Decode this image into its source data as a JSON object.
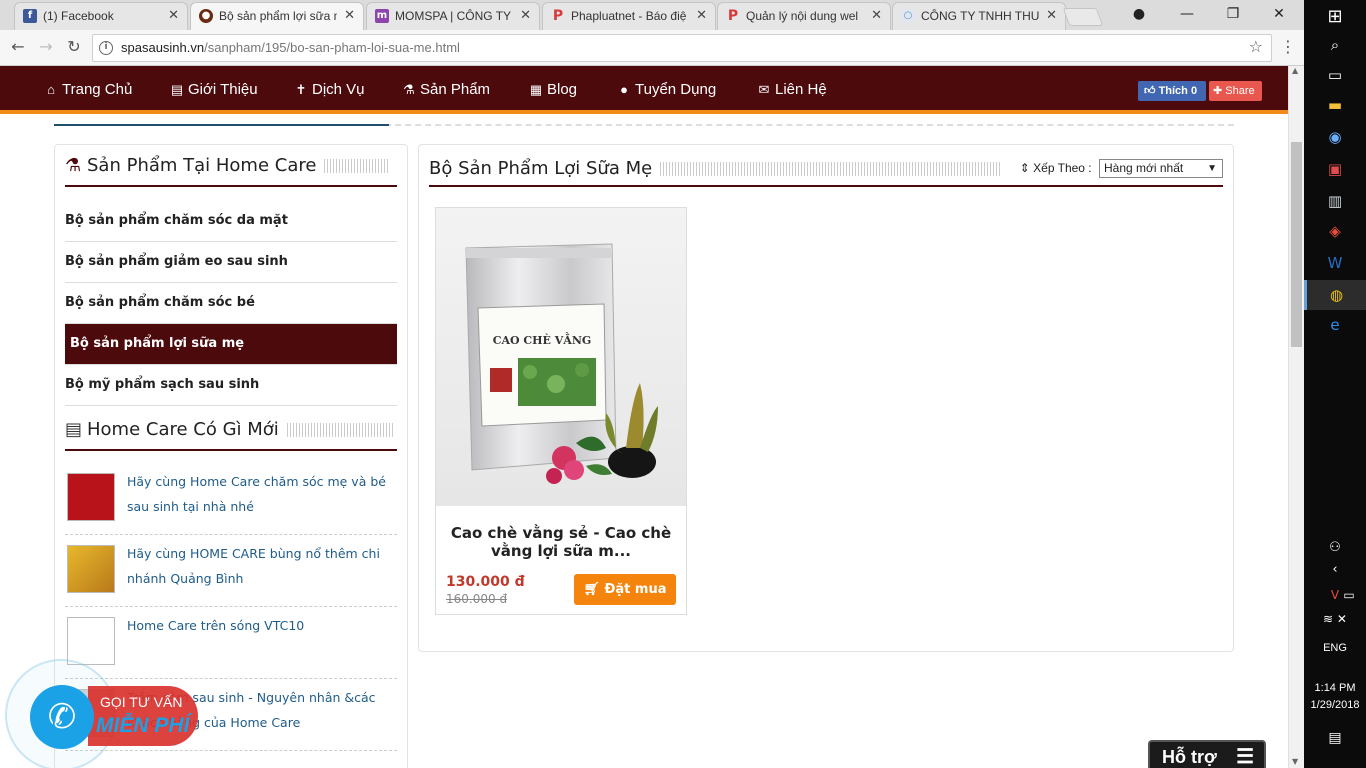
{
  "browser": {
    "tabs": [
      {
        "title": "(1) Facebook",
        "favicon": "facebook-icon",
        "color": "#3b5998",
        "glyph": "f"
      },
      {
        "title": "Bộ sản phẩm lợi sữa m",
        "favicon": "site-icon",
        "color": "#6b2a10",
        "glyph": "●"
      },
      {
        "title": "MOMSPA | CÔNG TY",
        "favicon": "momspa-icon",
        "color": "#8e44ad",
        "glyph": "m"
      },
      {
        "title": "Phapluatnet - Báo điệ",
        "favicon": "phapluat-icon",
        "color": "#d63a3a",
        "glyph": "P"
      },
      {
        "title": "Quản lý nội dung wel",
        "favicon": "phapluat-icon",
        "color": "#d63a3a",
        "glyph": "P"
      },
      {
        "title": "CÔNG TY TNHH THU",
        "favicon": "globe-icon",
        "color": "#6b8fb5",
        "glyph": "○"
      }
    ],
    "url_host": "spasausinh.vn",
    "url_path": "/sanpham/195/bo-san-pham-loi-sua-me.html"
  },
  "nav": {
    "items": [
      {
        "label": "Trang Chủ",
        "icon": "home-icon",
        "glyph": "⌂"
      },
      {
        "label": "Giới Thiệu",
        "icon": "building-icon",
        "glyph": "▤"
      },
      {
        "label": "Dịch Vụ",
        "icon": "pin-icon",
        "glyph": "✝"
      },
      {
        "label": "Sản Phẩm",
        "icon": "flask-icon",
        "glyph": "⚗"
      },
      {
        "label": "Blog",
        "icon": "newspaper-icon",
        "glyph": "▦"
      },
      {
        "label": "Tuyển Dụng",
        "icon": "user-icon",
        "glyph": "●"
      },
      {
        "label": "Liên Hệ",
        "icon": "envelope-icon",
        "glyph": "✉"
      }
    ],
    "like_label": "Thích 0",
    "share_label": "Share"
  },
  "sidebar": {
    "products_title": "Sản Phẩm Tại Home Care",
    "categories": [
      {
        "label": "Bộ sản phẩm chăm sóc da mặt",
        "active": false
      },
      {
        "label": "Bộ sản phẩm giảm eo sau sinh",
        "active": false
      },
      {
        "label": "Bộ sản phẩm chăm sóc bé",
        "active": false
      },
      {
        "label": "Bộ sản phẩm lợi sữa mẹ",
        "active": true
      },
      {
        "label": "Bộ mỹ phẩm sạch sau sinh",
        "active": false
      }
    ],
    "news_title": "Home Care Có Gì Mới",
    "news": [
      {
        "title": "Hãy cùng Home Care chăm sóc mẹ và bé sau sinh tại nhà nhé",
        "thumb": "#b8121b"
      },
      {
        "title": "Hãy cùng HOME CARE bùng nổ thêm chi nhánh Quảng Bình",
        "thumb": "#d9a520"
      },
      {
        "title": "Home Care trên sóng VTC10",
        "thumb": "#ffffff"
      },
      {
        "title": "Trầm cảm sau sinh - Nguyên nhân &các khách hàng của Home Care",
        "thumb": "#cfcfcf"
      }
    ]
  },
  "main": {
    "title": "Bộ Sản Phẩm Lợi Sữa Mẹ",
    "sort_label": "Xếp Theo :",
    "sort_value": "Hàng mới nhất",
    "product": {
      "name": "Cao chè vằng sẻ - Cao chè vằng lợi sữa m...",
      "package_label": "CAO CHÈ VẰNG",
      "price": "130.000 đ",
      "old_price": "160.000 đ",
      "buy_label": "Đặt mua"
    }
  },
  "widgets": {
    "call_line1": "GỌI TƯ VẤN",
    "call_line2": "MIỄN PHÍ",
    "support_label": "Hỗ trợ"
  },
  "taskbar": {
    "lang": "ENG",
    "time": "1:14 PM",
    "date": "1/29/2018"
  },
  "colors": {
    "brand": "#4d0a0d",
    "accent": "#f08a18",
    "link": "#1f5c8a",
    "price": "#c0392b"
  }
}
